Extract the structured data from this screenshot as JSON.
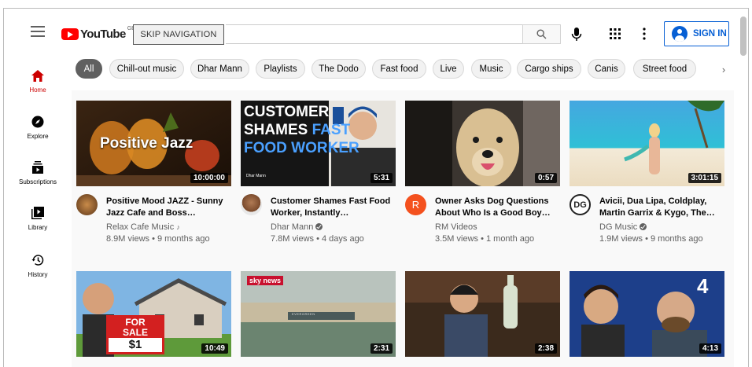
{
  "header": {
    "logo_text": "YouTube",
    "logo_region": "GB",
    "skip_navigation": "SKIP NAVIGATION",
    "search_placeholder": "",
    "signin_label": "SIGN IN"
  },
  "sidebar": {
    "items": [
      {
        "label": "Home",
        "icon": "home-icon",
        "active": true
      },
      {
        "label": "Explore",
        "icon": "compass-icon",
        "active": false
      },
      {
        "label": "Subscriptions",
        "icon": "subscriptions-icon",
        "active": false
      },
      {
        "label": "Library",
        "icon": "library-icon",
        "active": false
      },
      {
        "label": "History",
        "icon": "history-icon",
        "active": false
      }
    ]
  },
  "chips": [
    "All",
    "Chill-out music",
    "Dhar Mann",
    "Playlists",
    "The Dodo",
    "Fast food",
    "Live",
    "Music",
    "Cargo ships",
    "Canis",
    "Street food"
  ],
  "videos": [
    {
      "title": "Positive Mood JAZZ - Sunny Jazz Cafe and Boss…",
      "channel": "Relax Cafe Music",
      "channel_badge": "♪",
      "stats": "8.9M views • 9 months ago",
      "duration": "10:00:00",
      "thumb_text": "Positive Jazz"
    },
    {
      "title": "Customer Shames Fast Food Worker, Instantly…",
      "channel": "Dhar Mann",
      "verified": true,
      "stats": "7.8M views • 4 days ago",
      "duration": "5:31",
      "thumb_text_1": "CUSTOMER",
      "thumb_text_2": "SHAMES",
      "thumb_text_3": "FAST",
      "thumb_text_4": "FOOD WORKER",
      "thumb_small": "Dhar Mann"
    },
    {
      "title": "Owner Asks Dog Questions About Who Is a Good Boy…",
      "channel": "RM Videos",
      "stats": "3.5M views • 1 month ago",
      "duration": "0:57",
      "avatar_letter": "R"
    },
    {
      "title": "Avicii, Dua Lipa, Coldplay, Martin Garrix & Kygo, The…",
      "channel": "DG Music",
      "verified": true,
      "stats": "1.9M views • 9 months ago",
      "duration": "3:01:15",
      "avatar_letter": "DG"
    },
    {
      "duration": "10:49",
      "thumb_text_1": "FOR",
      "thumb_text_2": "SALE",
      "thumb_text_3": "$1"
    },
    {
      "duration": "2:31",
      "thumb_logo": "sky news",
      "thumb_ship": "EVERGREEN"
    },
    {
      "duration": "2:38"
    },
    {
      "duration": "4:13",
      "thumb_logo": "4"
    }
  ]
}
